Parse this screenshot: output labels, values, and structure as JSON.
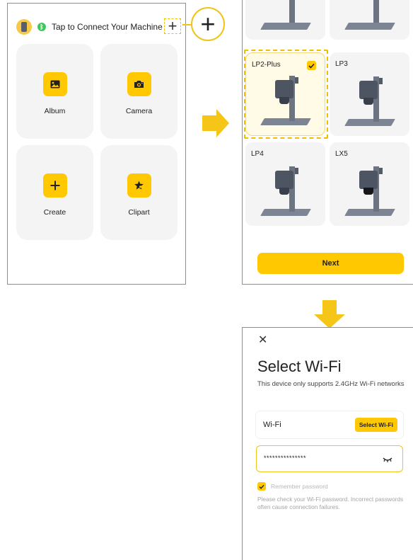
{
  "colors": {
    "accent": "#ffc800",
    "accent_border": "#f0bf00",
    "tile_bg": "#f4f4f4",
    "connected_green": "#3fc75d"
  },
  "home": {
    "connect_text": "Tap to Connect Your Machine",
    "status_icon": "bluetooth-icon",
    "add_icon": "plus-icon",
    "tiles": [
      {
        "label": "Album",
        "icon": "image-icon"
      },
      {
        "label": "Camera",
        "icon": "camera-icon"
      },
      {
        "label": "Create",
        "icon": "plus-icon"
      },
      {
        "label": "Clipart",
        "icon": "clipart-icon"
      }
    ]
  },
  "callout": {
    "icon": "plus-icon",
    "glyph": "+"
  },
  "models": {
    "cards": [
      {
        "name": "LP2-Plus",
        "selected": true
      },
      {
        "name": "LP3",
        "selected": false
      },
      {
        "name": "LP4",
        "selected": false
      },
      {
        "name": "LX5",
        "selected": false
      }
    ],
    "next_label": "Next"
  },
  "wifi": {
    "title": "Select Wi-Fi",
    "subtitle": "This device only supports 2.4GHz Wi-Fi networks",
    "wifi_label": "Wi-Fi",
    "select_button": "Select Wi-Fi",
    "password_value": "***************",
    "remember_label": "Remember password",
    "note": "Please check your Wi-Fi password. Incorrect passwords often cause connection failures."
  }
}
